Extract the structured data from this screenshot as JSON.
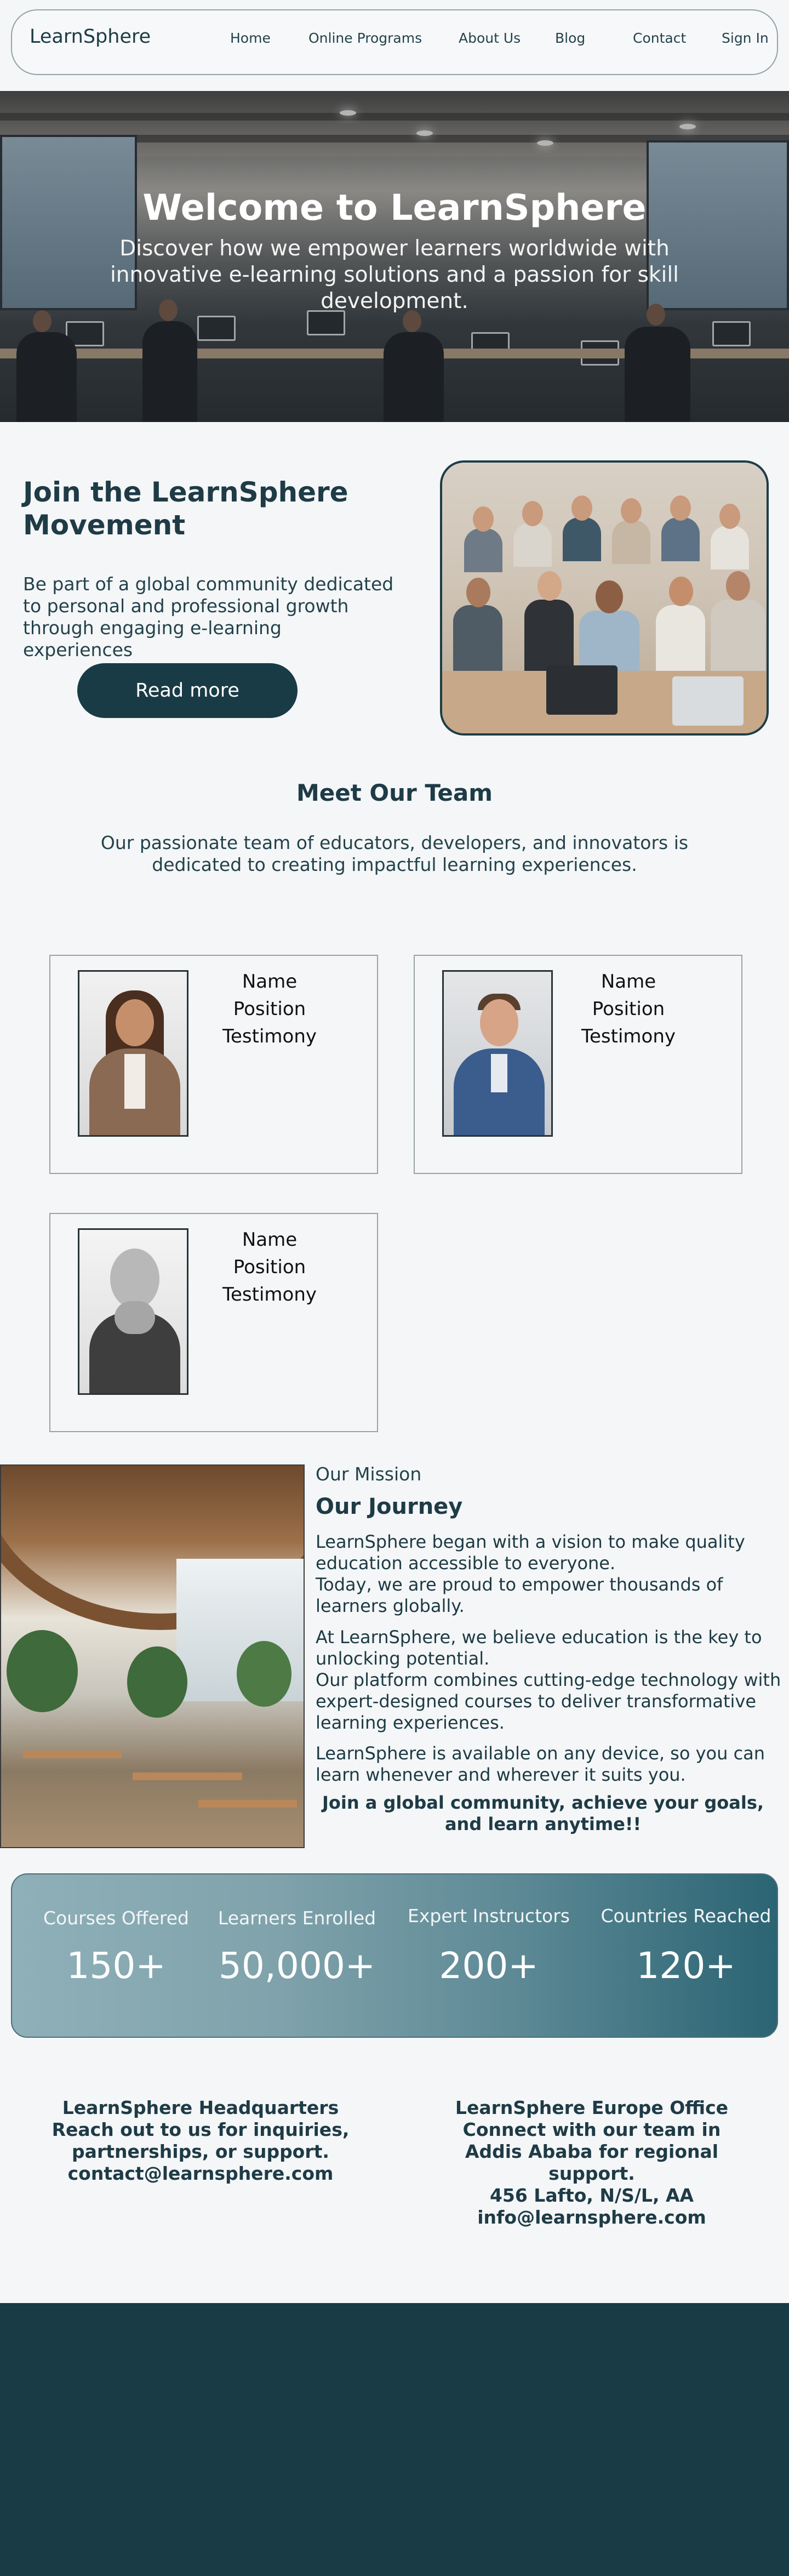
{
  "nav": {
    "brand": "LearnSphere",
    "links": [
      "Home",
      "Online Programs",
      "About Us",
      "Blog",
      "Contact",
      "Sign In"
    ]
  },
  "hero": {
    "title": "Welcome to LearnSphere",
    "subtitle": "Discover how we empower learners worldwide with innovative e-learning solutions and a passion for skill development."
  },
  "join": {
    "title": "Join the LearnSphere Movement",
    "text": "Be part of a global community dedicated to personal and professional growth through engaging e-learning experiences",
    "button": "Read more"
  },
  "team": {
    "title": "Meet Our Team",
    "subtitle": "Our passionate team of educators, developers, and innovators is dedicated to creating impactful learning experiences.",
    "members": [
      {
        "name": "Name",
        "position": "Position",
        "testimony": "Testimony"
      },
      {
        "name": "Name",
        "position": "Position",
        "testimony": "Testimony"
      },
      {
        "name": "Name",
        "position": "Position",
        "testimony": "Testimony"
      }
    ]
  },
  "mission": {
    "kicker": "Our Mission",
    "title": "Our Journey",
    "p1": "LearnSphere began with a vision to make quality education accessible to everyone.",
    "p2": "Today, we are proud to empower thousands of learners globally.",
    "p3": "At LearnSphere, we believe education is the key to unlocking potential.",
    "p4": "Our platform combines cutting-edge technology with expert-designed courses to deliver transformative learning experiences.",
    "p5": "LearnSphere is available on any device, so you can learn whenever and wherever it suits you.",
    "closing": "Join a global community, achieve your goals, and learn anytime!!"
  },
  "stats": [
    {
      "label": "Courses Offered",
      "value": "150+"
    },
    {
      "label": "Learners Enrolled",
      "value": "50,000+"
    },
    {
      "label": "Expert Instructors",
      "value": "200+"
    },
    {
      "label": "Countries Reached",
      "value": "120+"
    }
  ],
  "contact": {
    "hq": {
      "title": "LearnSphere Headquarters",
      "line1": "Reach out to us for inquiries, partnerships, or support.",
      "email": "contact@learnsphere.com"
    },
    "europe": {
      "title": "LearnSphere Europe Office",
      "line1": "Connect with our team in Addis Ababa for regional support.",
      "address": "456 Lafto, N/S/L, AA",
      "email": "info@learnsphere.com"
    }
  },
  "colors": {
    "primary": "#193b46",
    "background": "#f4f6f7",
    "footer": "#183b45",
    "stats_gradient_start": "#8fb0b8",
    "stats_gradient_end": "#2b6473"
  }
}
